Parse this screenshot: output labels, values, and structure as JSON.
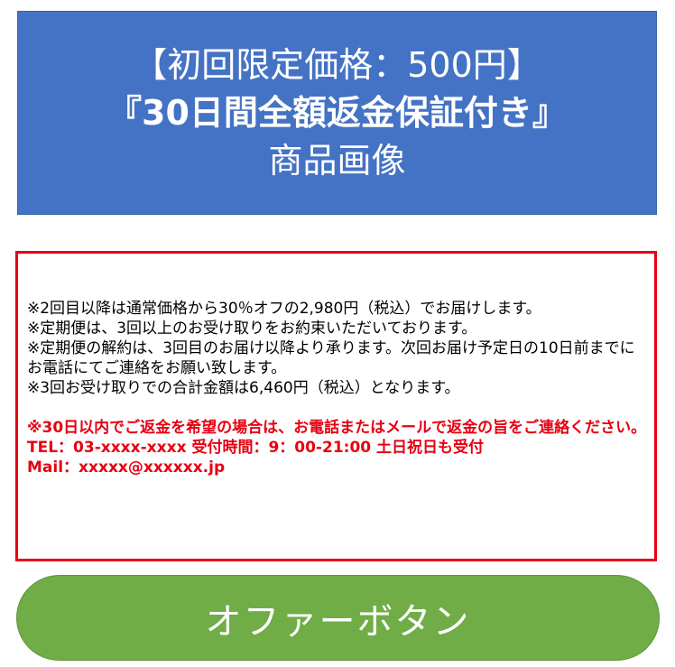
{
  "hero": {
    "line1": "【初回限定価格：500円】",
    "line2": "『30日間全額返金保証付き』",
    "line3": "商品画像"
  },
  "notice": {
    "lines": [
      "※2回目以降は通常価格から30％オフの2,980円（税込）でお届けします。",
      "※定期便は、3回以上のお受け取りをお約束いただいております。",
      "※定期便の解約は、3回目のお届け以降より承ります。次回お届け予定日の10日前までにお電話にてご連絡をお願い致します。",
      "※3回お受け取りでの合計金額は6,460円（税込）となります。"
    ],
    "refund": "※30日以内でご返金を希望の場合は、お電話またはメールで返金の旨をご連絡ください。",
    "tel": "TEL：03-xxxx-xxxx 受付時間：9：00-21:00 土日祝日も受付",
    "mail": "Mail：xxxxx@xxxxxx.jp"
  },
  "offer_button": {
    "label": "オファーボタン"
  },
  "colors": {
    "hero_bg": "#4472c4",
    "notice_border": "#e60012",
    "warning_text": "#e60012",
    "button_bg": "#70ad47"
  }
}
